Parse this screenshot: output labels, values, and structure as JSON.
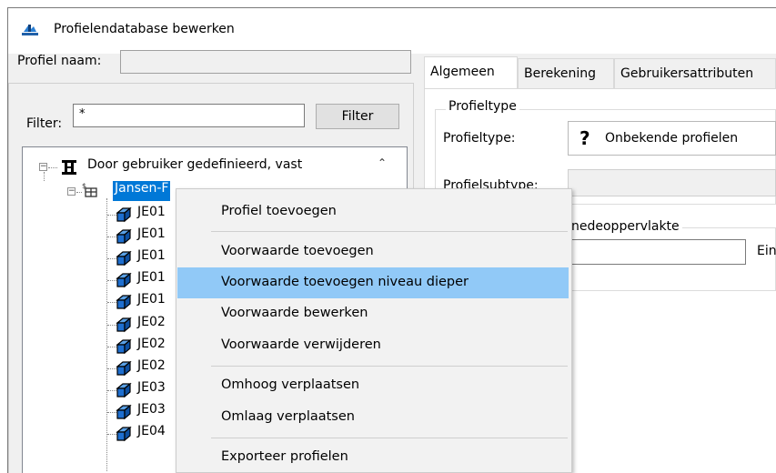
{
  "window": {
    "title": "Profielendatabase bewerken"
  },
  "profile_name": {
    "label": "Profiel naam:",
    "value": ""
  },
  "filter": {
    "label": "Filter:",
    "value": "*",
    "button": "Filter"
  },
  "tree": {
    "root": "Door gebruiker gedefinieerd, vast",
    "selected": "Jansen-F",
    "children": [
      "JE01",
      "JE01",
      "JE01",
      "JE01",
      "JE01",
      "JE02",
      "JE02",
      "JE02",
      "JE03",
      "JE03",
      "JE04"
    ]
  },
  "tabs": [
    "Algemeen",
    "Berekening",
    "Gebruikersattributen"
  ],
  "general": {
    "group_profieltype": "Profieltype",
    "profieltype_label": "Profieltype:",
    "profieltype_icon": "?",
    "profieltype_value": "Onbekende profielen",
    "profielsubtype_label": "Profielsubtype:",
    "group_area": "nedeoppervlakte",
    "unit_label": "Ein"
  },
  "context_menu": {
    "items": [
      "Profiel toevoegen",
      "Voorwaarde toevoegen",
      "Voorwaarde toevoegen niveau dieper",
      "Voorwaarde bewerken",
      "Voorwaarde verwijderen",
      "Omhoog verplaatsen",
      "Omlaag verplaatsen",
      "Exporteer profielen"
    ],
    "highlighted_index": 2
  }
}
